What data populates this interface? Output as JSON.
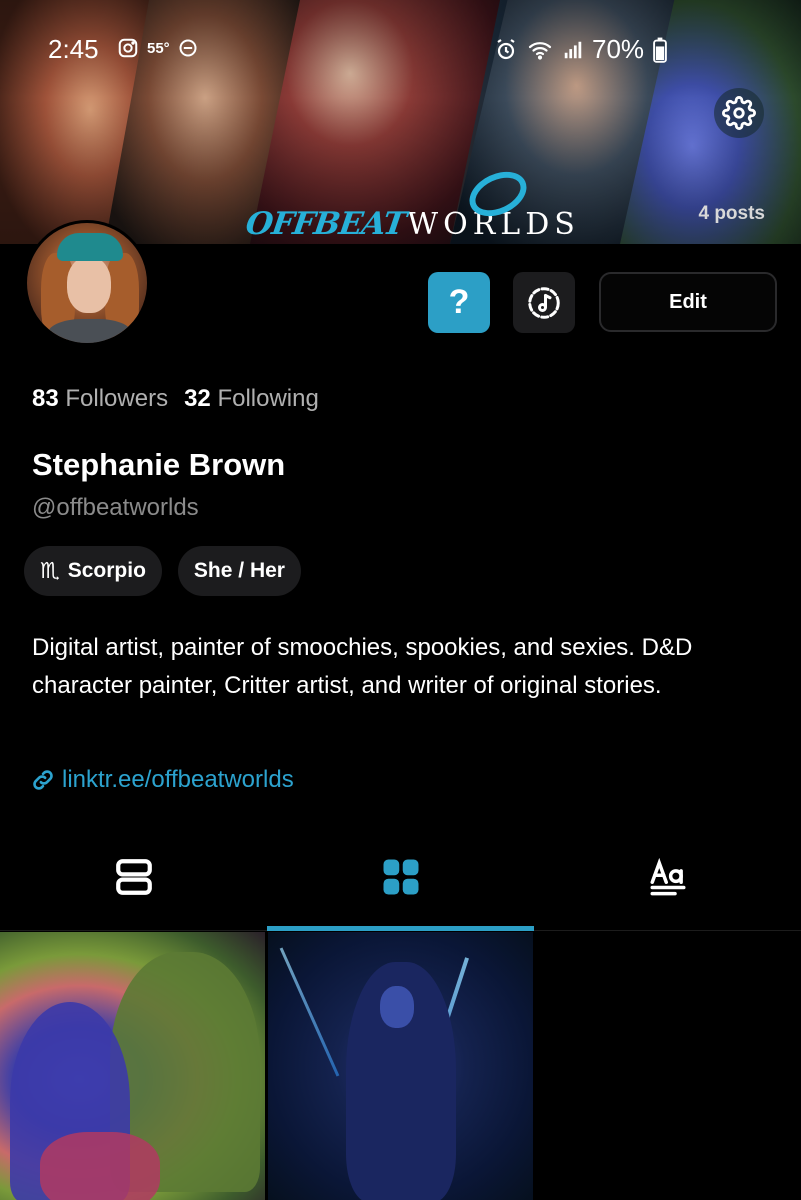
{
  "status_bar": {
    "time": "2:45",
    "temperature": "55°",
    "battery": "70%",
    "icons": [
      "instagram-icon",
      "dnd-icon",
      "alarm-icon",
      "wifi-icon",
      "signal-icon",
      "battery-icon"
    ]
  },
  "banner": {
    "logo_part1": "OFFBEAT",
    "logo_part2": "WORLDS",
    "posts_count": "4 posts",
    "settings_icon": "gear-icon"
  },
  "profile": {
    "followers_count": "83",
    "followers_label": "Followers",
    "following_count": "32",
    "following_label": "Following",
    "display_name": "Stephanie Brown",
    "handle": "@offbeatworlds",
    "zodiac_symbol": "♏",
    "zodiac_label": "Scorpio",
    "pronouns": "She / Her",
    "bio": "Digital artist, painter of smoochies, spookies, and sexies. D&D character painter, Critter artist, and writer of original stories.",
    "link": "linktr.ee/offbeatworlds"
  },
  "actions": {
    "help_label": "?",
    "edit_label": "Edit"
  },
  "tabs": [
    {
      "name": "list-view",
      "icon": "list-view-icon"
    },
    {
      "name": "grid-view",
      "icon": "grid-view-icon",
      "active": true
    },
    {
      "name": "text-posts",
      "icon": "text-format-icon"
    }
  ],
  "colors": {
    "accent": "#2c9fc6",
    "background": "#000000",
    "chip_bg": "#1c1c1e",
    "link": "#2ca3cf"
  }
}
